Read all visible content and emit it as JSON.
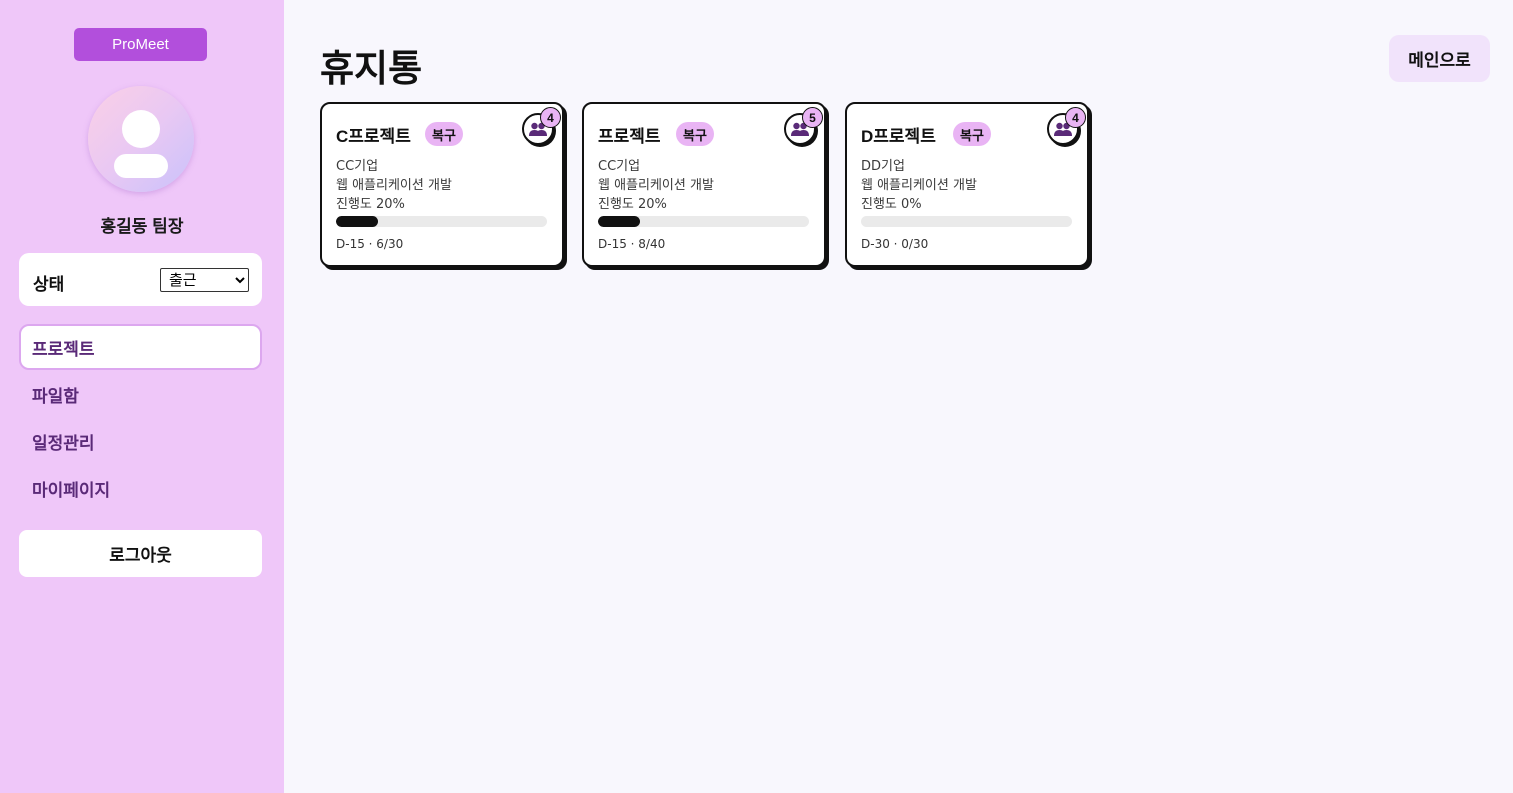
{
  "sidebar": {
    "brand": "ProMeet",
    "user_name": "홍길동 팀장",
    "status_label": "상태",
    "status_value": "출근",
    "nav": [
      {
        "label": "프로젝트",
        "active": true
      },
      {
        "label": "파일함",
        "active": false
      },
      {
        "label": "일정관리",
        "active": false
      },
      {
        "label": "마이페이지",
        "active": false
      }
    ],
    "logout": "로그아웃"
  },
  "main": {
    "title": "휴지통",
    "back_button": "메인으로",
    "cards": [
      {
        "title": "C프로젝트",
        "restore": "복구",
        "members": "4",
        "company": "CC기업",
        "type": "웹 애플리케이션 개발",
        "progress_text": "진행도 20%",
        "progress": 20,
        "footer": "D-15 · 6/30"
      },
      {
        "title": "프로젝트",
        "restore": "복구",
        "members": "5",
        "company": "CC기업",
        "type": "웹 애플리케이션 개발",
        "progress_text": "진행도 20%",
        "progress": 20,
        "footer": "D-15 · 8/40"
      },
      {
        "title": "D프로젝트",
        "restore": "복구",
        "members": "4",
        "company": "DD기업",
        "type": "웹 애플리케이션 개발",
        "progress_text": "진행도 0%",
        "progress": 0,
        "footer": "D-30 · 0/30"
      }
    ]
  },
  "colors": {
    "sidebar_bg": "#efc7f9",
    "brand": "#b24fdc",
    "badge": "#e9b4f4",
    "nav_text": "#5a2a78",
    "page_bg": "#f8f7fd"
  },
  "icons": {
    "members": "users-icon",
    "avatar": "user-avatar-icon"
  }
}
